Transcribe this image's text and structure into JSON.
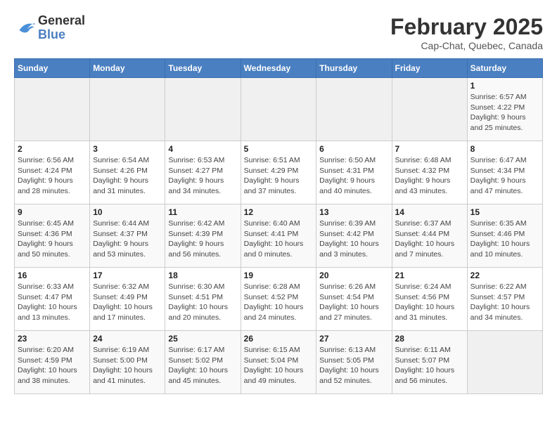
{
  "logo": {
    "line1": "General",
    "line2": "Blue"
  },
  "header": {
    "month": "February 2025",
    "location": "Cap-Chat, Quebec, Canada"
  },
  "weekdays": [
    "Sunday",
    "Monday",
    "Tuesday",
    "Wednesday",
    "Thursday",
    "Friday",
    "Saturday"
  ],
  "weeks": [
    [
      {
        "day": "",
        "info": ""
      },
      {
        "day": "",
        "info": ""
      },
      {
        "day": "",
        "info": ""
      },
      {
        "day": "",
        "info": ""
      },
      {
        "day": "",
        "info": ""
      },
      {
        "day": "",
        "info": ""
      },
      {
        "day": "1",
        "info": "Sunrise: 6:57 AM\nSunset: 4:22 PM\nDaylight: 9 hours and 25 minutes."
      }
    ],
    [
      {
        "day": "2",
        "info": "Sunrise: 6:56 AM\nSunset: 4:24 PM\nDaylight: 9 hours and 28 minutes."
      },
      {
        "day": "3",
        "info": "Sunrise: 6:54 AM\nSunset: 4:26 PM\nDaylight: 9 hours and 31 minutes."
      },
      {
        "day": "4",
        "info": "Sunrise: 6:53 AM\nSunset: 4:27 PM\nDaylight: 9 hours and 34 minutes."
      },
      {
        "day": "5",
        "info": "Sunrise: 6:51 AM\nSunset: 4:29 PM\nDaylight: 9 hours and 37 minutes."
      },
      {
        "day": "6",
        "info": "Sunrise: 6:50 AM\nSunset: 4:31 PM\nDaylight: 9 hours and 40 minutes."
      },
      {
        "day": "7",
        "info": "Sunrise: 6:48 AM\nSunset: 4:32 PM\nDaylight: 9 hours and 43 minutes."
      },
      {
        "day": "8",
        "info": "Sunrise: 6:47 AM\nSunset: 4:34 PM\nDaylight: 9 hours and 47 minutes."
      }
    ],
    [
      {
        "day": "9",
        "info": "Sunrise: 6:45 AM\nSunset: 4:36 PM\nDaylight: 9 hours and 50 minutes."
      },
      {
        "day": "10",
        "info": "Sunrise: 6:44 AM\nSunset: 4:37 PM\nDaylight: 9 hours and 53 minutes."
      },
      {
        "day": "11",
        "info": "Sunrise: 6:42 AM\nSunset: 4:39 PM\nDaylight: 9 hours and 56 minutes."
      },
      {
        "day": "12",
        "info": "Sunrise: 6:40 AM\nSunset: 4:41 PM\nDaylight: 10 hours and 0 minutes."
      },
      {
        "day": "13",
        "info": "Sunrise: 6:39 AM\nSunset: 4:42 PM\nDaylight: 10 hours and 3 minutes."
      },
      {
        "day": "14",
        "info": "Sunrise: 6:37 AM\nSunset: 4:44 PM\nDaylight: 10 hours and 7 minutes."
      },
      {
        "day": "15",
        "info": "Sunrise: 6:35 AM\nSunset: 4:46 PM\nDaylight: 10 hours and 10 minutes."
      }
    ],
    [
      {
        "day": "16",
        "info": "Sunrise: 6:33 AM\nSunset: 4:47 PM\nDaylight: 10 hours and 13 minutes."
      },
      {
        "day": "17",
        "info": "Sunrise: 6:32 AM\nSunset: 4:49 PM\nDaylight: 10 hours and 17 minutes."
      },
      {
        "day": "18",
        "info": "Sunrise: 6:30 AM\nSunset: 4:51 PM\nDaylight: 10 hours and 20 minutes."
      },
      {
        "day": "19",
        "info": "Sunrise: 6:28 AM\nSunset: 4:52 PM\nDaylight: 10 hours and 24 minutes."
      },
      {
        "day": "20",
        "info": "Sunrise: 6:26 AM\nSunset: 4:54 PM\nDaylight: 10 hours and 27 minutes."
      },
      {
        "day": "21",
        "info": "Sunrise: 6:24 AM\nSunset: 4:56 PM\nDaylight: 10 hours and 31 minutes."
      },
      {
        "day": "22",
        "info": "Sunrise: 6:22 AM\nSunset: 4:57 PM\nDaylight: 10 hours and 34 minutes."
      }
    ],
    [
      {
        "day": "23",
        "info": "Sunrise: 6:20 AM\nSunset: 4:59 PM\nDaylight: 10 hours and 38 minutes."
      },
      {
        "day": "24",
        "info": "Sunrise: 6:19 AM\nSunset: 5:00 PM\nDaylight: 10 hours and 41 minutes."
      },
      {
        "day": "25",
        "info": "Sunrise: 6:17 AM\nSunset: 5:02 PM\nDaylight: 10 hours and 45 minutes."
      },
      {
        "day": "26",
        "info": "Sunrise: 6:15 AM\nSunset: 5:04 PM\nDaylight: 10 hours and 49 minutes."
      },
      {
        "day": "27",
        "info": "Sunrise: 6:13 AM\nSunset: 5:05 PM\nDaylight: 10 hours and 52 minutes."
      },
      {
        "day": "28",
        "info": "Sunrise: 6:11 AM\nSunset: 5:07 PM\nDaylight: 10 hours and 56 minutes."
      },
      {
        "day": "",
        "info": ""
      }
    ]
  ]
}
